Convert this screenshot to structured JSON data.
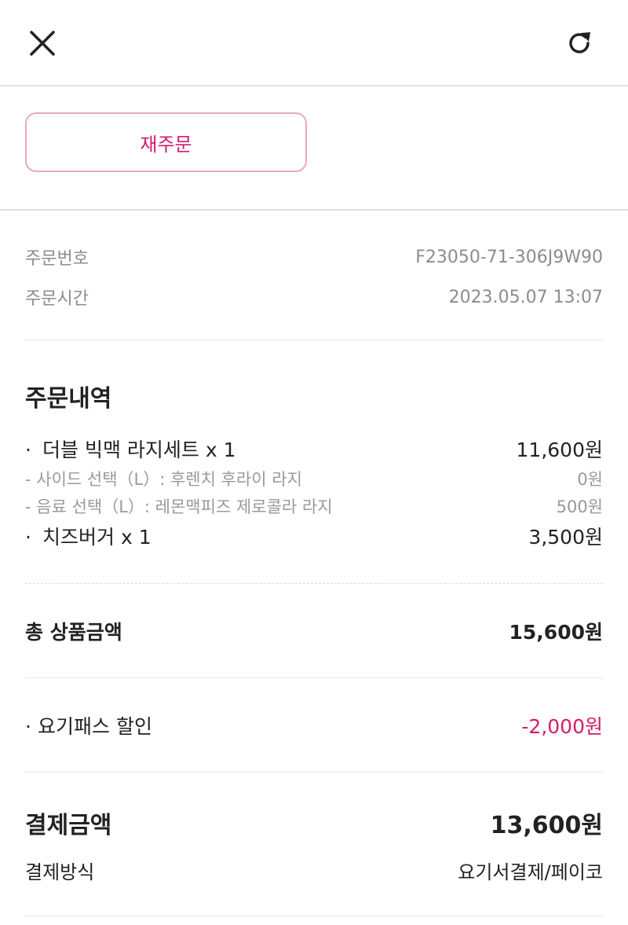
{
  "header": {
    "close_icon": "close-icon",
    "refresh_icon": "refresh-icon"
  },
  "reorder": {
    "label": "재주문"
  },
  "order_info": {
    "number_label": "주문번호",
    "number_value": "F23050-71-306J9W90",
    "time_label": "주문시간",
    "time_value": "2023.05.07 13:07"
  },
  "order_details": {
    "title": "주문내역",
    "items": [
      {
        "text": "더블 빅맥 라지세트 x 1",
        "price": "11,600원"
      },
      {
        "text": "- 사이드 선택（L）: 후렌치 후라이 라지",
        "price": "0원"
      },
      {
        "text": "- 음료 선택（L）: 레몬맥피즈 제로콜라 라지",
        "price": "500원"
      },
      {
        "text": "치즈버거 x 1",
        "price": "3,500원"
      }
    ],
    "bullet": "·"
  },
  "subtotal": {
    "label": "총 상품금액",
    "value": "15,600원"
  },
  "discount": {
    "label": "요기패스 할인",
    "value": "-2,000원"
  },
  "payment": {
    "total_label": "결제금액",
    "total_value": "13,600원",
    "method_label": "결제방식",
    "method_value": "요기서결제/페이코"
  },
  "colors": {
    "accent": "#d21c6b",
    "accent_border": "#eaa7c3",
    "muted": "#8c8c8c"
  }
}
